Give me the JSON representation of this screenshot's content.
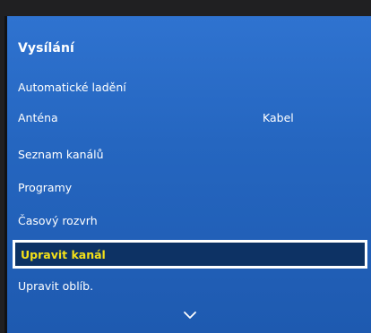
{
  "panel": {
    "title": "Vysílání"
  },
  "menu": {
    "items": [
      {
        "label": "Automatické ladění",
        "value": ""
      },
      {
        "label": "Anténa",
        "value": "Kabel"
      },
      {
        "label": "Seznam kanálů",
        "value": ""
      },
      {
        "label": "Programy",
        "value": ""
      },
      {
        "label": "Časový rozvrh",
        "value": ""
      },
      {
        "label": "Upravit kanál",
        "value": "",
        "selected": true
      },
      {
        "label": "Upravit oblíb.",
        "value": ""
      }
    ]
  },
  "colors": {
    "panel_blue": "#2566c0",
    "selected_bg": "#0d3264",
    "selected_text": "#f4e118",
    "text": "#ffffff"
  },
  "icons": {
    "scroll_down": "chevron-down-icon"
  }
}
